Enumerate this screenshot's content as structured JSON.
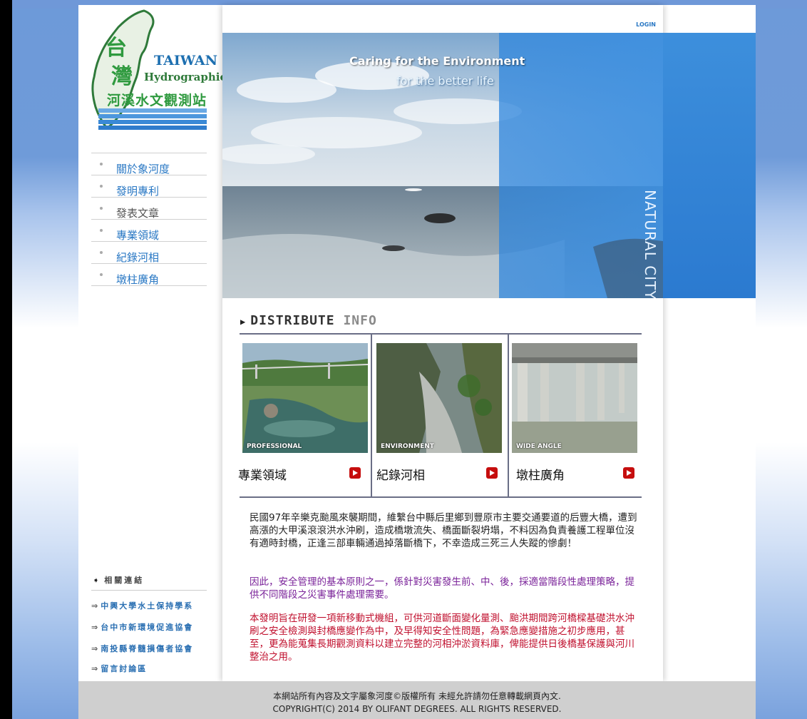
{
  "logo": {
    "chinese_title_top": "台",
    "chinese_title_bottom": "灣",
    "english_line1": "TAIWAN",
    "english_line2": "Hydrographic",
    "chinese_subtitle": "河溪水文觀測站"
  },
  "nav": {
    "items": [
      {
        "label": "關於象河度"
      },
      {
        "label": "發明專利"
      },
      {
        "label": "發表文章"
      },
      {
        "label": "專業領域"
      },
      {
        "label": "紀錄河相"
      },
      {
        "label": "墩柱廣角"
      }
    ]
  },
  "related": {
    "title": "相關連結",
    "links": [
      {
        "label": "中興大學水土保持學系"
      },
      {
        "label": "台中市新環境促進協會"
      },
      {
        "label": "南投縣脊髓損傷者協會"
      },
      {
        "label": "留言討論區"
      }
    ]
  },
  "header": {
    "login_label": "LOGIN"
  },
  "hero": {
    "tagline1": "Caring for the Environment",
    "tagline2": "for the better life",
    "side_text": "NATURAL CITY"
  },
  "distribute": {
    "title_bold": "DISTRIBUTE",
    "title_light": "INFO",
    "items": [
      {
        "caption": "PROFESSIONAL",
        "label": "專業領域"
      },
      {
        "caption": "ENVIRONMENT",
        "label": "紀錄河相"
      },
      {
        "caption": "WIDE ANGLE",
        "label": "墩柱廣角"
      }
    ]
  },
  "content": {
    "p1": "民國97年辛樂克颱風來襲期間，維繫台中縣后里鄉到豐原市主要交通要道的后豐大橋，遭到高漲的大甲溪滾滾洪水沖刷，造成橋墩流失、橋面斷裂坍塌，不料因為負責養護工程單位沒有適時封橋，正逢三部車輛通過掉落斷橋下，不幸造成三死三人失蹤的慘劇！",
    "p2": "因此，安全管理的基本原則之一，係針對災害發生前、中、後，採適當階段性處理策略，提供不同階段之災害事件處理需要。",
    "p3": "本發明旨在研發一項新移動式機組，可供河道斷面變化量測、颱洪期間跨河橋樑基礎洪水沖刷之安全檢測與封橋應變作為中，及早得知安全性問題，為緊急應變措施之初步應用，甚至，更為能蒐集長期觀測資料以建立完整的河相沖淤資料庫，俾能提供日後橋基保護與河川整治之用。"
  },
  "footer": {
    "line1": "本網站所有內容及文字屬象河度©版權所有 未經允許請勿任意轉載網頁內文.",
    "line2": "COPYRIGHT(C) 2014 BY OLIFANT DEGREES. ALL RIGHTS RESERVED."
  }
}
